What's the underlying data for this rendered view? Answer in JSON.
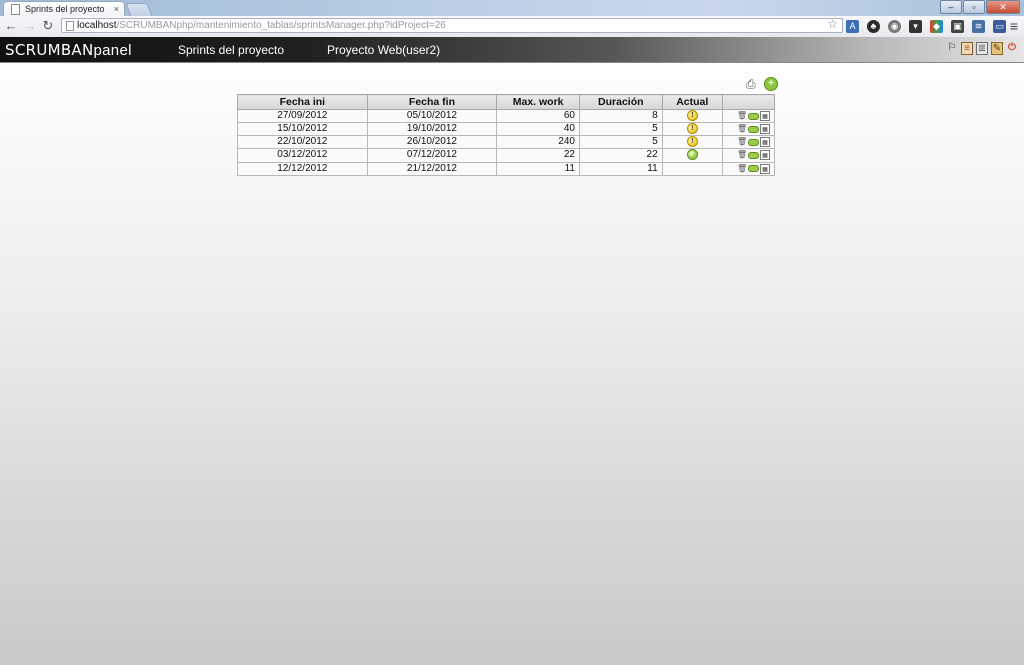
{
  "browser": {
    "tab_title": "Sprints del proyecto",
    "tab_close": "×",
    "url_host": "localhost",
    "url_path": "/SCRUMBANphp/mantenimiento_tablas/sprintsManager.php?idProject=26"
  },
  "app": {
    "brand_part1": "SCRUMBAN",
    "brand_part2": "panel",
    "nav_sprints": "Sprints del proyecto",
    "nav_project": "Proyecto Web(user2)"
  },
  "table": {
    "headers": [
      "Fecha ini",
      "Fecha fin",
      "Max. work",
      "Duración",
      "Actual",
      ""
    ],
    "rows": [
      {
        "start": "27/09/2012",
        "end": "05/10/2012",
        "max_work": "60",
        "duration": "8",
        "actual": "warn"
      },
      {
        "start": "15/10/2012",
        "end": "19/10/2012",
        "max_work": "40",
        "duration": "5",
        "actual": "warn"
      },
      {
        "start": "22/10/2012",
        "end": "26/10/2012",
        "max_work": "240",
        "duration": "5",
        "actual": "warn"
      },
      {
        "start": "03/12/2012",
        "end": "07/12/2012",
        "max_work": "22",
        "duration": "22",
        "actual": "ok"
      },
      {
        "start": "12/12/2012",
        "end": "21/12/2012",
        "max_work": "11",
        "duration": "11",
        "actual": "none"
      }
    ]
  }
}
